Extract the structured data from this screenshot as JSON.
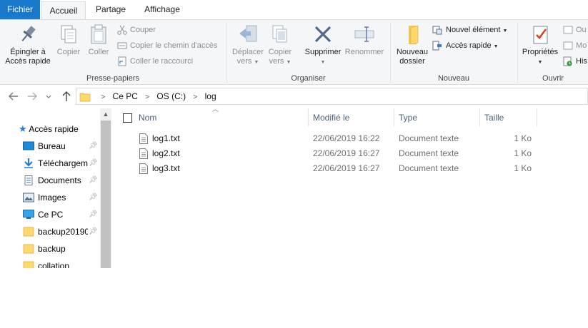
{
  "tabs": {
    "file": "Fichier",
    "home": "Accueil",
    "share": "Partage",
    "view": "Affichage"
  },
  "ribbon": {
    "clipboard": {
      "label": "Presse-papiers",
      "pin_line1": "Épingler à",
      "pin_line2": "Accès rapide",
      "copy": "Copier",
      "paste": "Coller",
      "cut": "Couper",
      "copy_path": "Copier le chemin d'accès",
      "paste_shortcut": "Coller le raccourci"
    },
    "organize": {
      "label": "Organiser",
      "move_line1": "Déplacer",
      "move_line2": "vers",
      "copyto_line1": "Copier",
      "copyto_line2": "vers",
      "delete": "Supprimer",
      "rename": "Renommer"
    },
    "new": {
      "label": "Nouveau",
      "new_folder_line1": "Nouveau",
      "new_folder_line2": "dossier",
      "new_item": "Nouvel élément",
      "easy_access": "Accès rapide"
    },
    "open": {
      "label": "Ouvrir",
      "properties": "Propriétés",
      "open_clipped": "Ou",
      "modify_clipped": "Mo",
      "history_clipped": "His"
    }
  },
  "address": {
    "crumbs": [
      "Ce PC",
      "OS (C:)",
      "log"
    ]
  },
  "navpane": {
    "quick_access": "Accès rapide",
    "items": [
      {
        "label": "Bureau",
        "icon": "desktop-icon",
        "pinned": true
      },
      {
        "label": "Téléchargements",
        "icon": "download-icon",
        "pinned": true
      },
      {
        "label": "Documents",
        "icon": "documents-icon",
        "pinned": true
      },
      {
        "label": "Images",
        "icon": "pictures-icon",
        "pinned": true
      },
      {
        "label": "Ce PC",
        "icon": "computer-icon",
        "pinned": true
      },
      {
        "label": "backup20190",
        "icon": "folder-icon",
        "pinned": true
      },
      {
        "label": "backup",
        "icon": "folder-icon",
        "pinned": false
      },
      {
        "label": "collation",
        "icon": "folder-icon",
        "pinned": false
      }
    ]
  },
  "list": {
    "columns": {
      "name": "Nom",
      "modified": "Modifié le",
      "type": "Type",
      "size": "Taille"
    },
    "rows": [
      {
        "name": "log1.txt",
        "modified": "22/06/2019 16:22",
        "type": "Document texte",
        "size": "1 Ko"
      },
      {
        "name": "log2.txt",
        "modified": "22/06/2019 16:27",
        "type": "Document texte",
        "size": "1 Ko"
      },
      {
        "name": "log3.txt",
        "modified": "22/06/2019 16:27",
        "type": "Document texte",
        "size": "1 Ko"
      }
    ]
  },
  "colors": {
    "file_tab": "#1979ca",
    "ribbon_bg": "#f5f6f7",
    "header_text": "#4c607a"
  }
}
